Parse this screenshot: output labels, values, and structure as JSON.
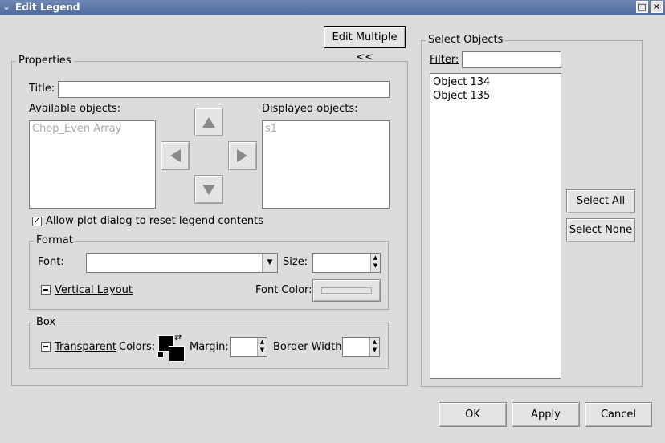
{
  "window": {
    "title": "Edit Legend"
  },
  "buttons": {
    "edit_multiple": "Edit Multiple <<",
    "select_all": "Select All",
    "select_none": "Select None",
    "ok": "OK",
    "apply": "Apply",
    "cancel": "Cancel"
  },
  "properties": {
    "group_label": "Properties",
    "title_label": "Title:",
    "title_value": "",
    "available_label": "Available objects:",
    "available_items": [
      "Chop_Even Array"
    ],
    "displayed_label": "Displayed objects:",
    "displayed_items": [
      "s1"
    ],
    "allow_reset_label": "Allow plot dialog to reset legend contents",
    "allow_reset_checked": true
  },
  "format": {
    "group_label": "Format",
    "font_label": "Font:",
    "font_value": "",
    "size_label": "Size:",
    "size_value": "",
    "vertical_layout_label": "Vertical Layout",
    "font_color_label": "Font Color:"
  },
  "box": {
    "group_label": "Box",
    "transparent_label": "Transparent",
    "colors_label": "Colors:",
    "margin_label": "Margin:",
    "margin_value": "",
    "border_width_label": "Border Width:",
    "border_width_value": ""
  },
  "select_objects": {
    "group_label": "Select Objects",
    "filter_label": "Filter:",
    "filter_value": "",
    "items": [
      "Object 134",
      "Object 135"
    ]
  },
  "colors": {
    "titlebar": "#5a74a8",
    "dialog_bg": "#dcdcdc"
  }
}
